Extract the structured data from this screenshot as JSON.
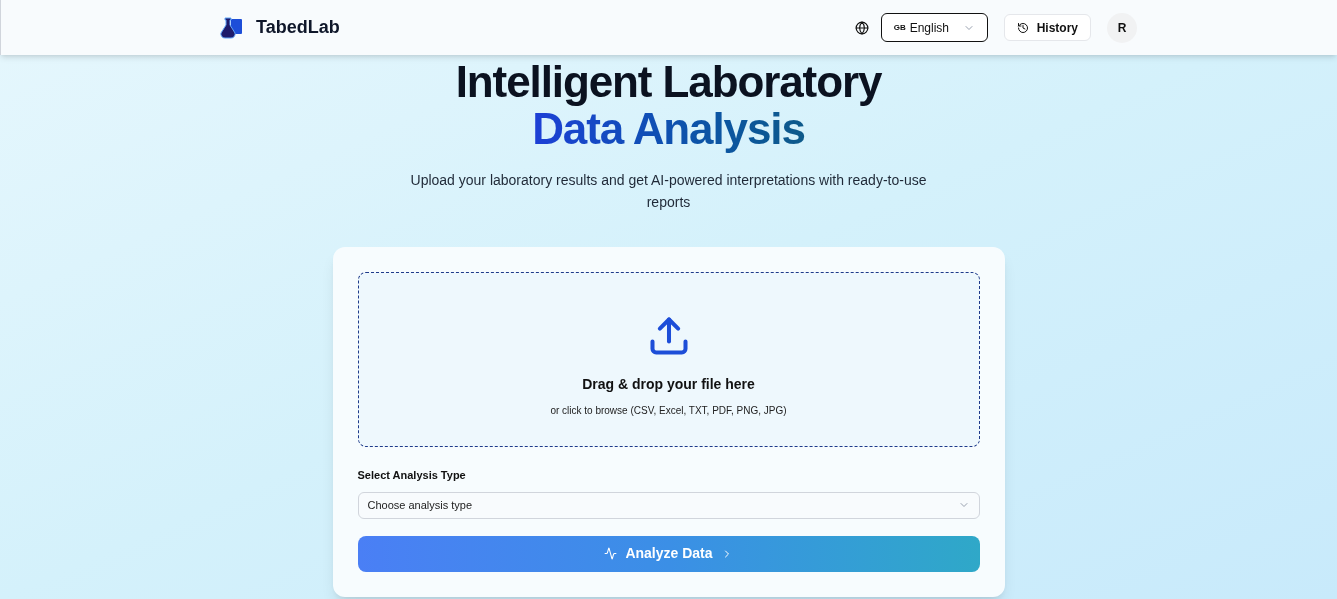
{
  "header": {
    "brand": "TabedLab",
    "language": {
      "flag": "GB",
      "label": "English"
    },
    "history_button": "History",
    "avatar": "R"
  },
  "hero": {
    "title_line1": "Intelligent Laboratory",
    "title_line2": "Data Analysis",
    "subtitle": "Upload your laboratory results and get AI-powered interpretations with ready-to-use reports"
  },
  "upload": {
    "title": "Drag & drop your file here",
    "hint": "or click to browse (CSV, Excel, TXT, PDF, PNG, JPG)"
  },
  "analysis_type": {
    "label": "Select Analysis Type",
    "placeholder": "Choose analysis type"
  },
  "analyze_button": "Analyze Data"
}
